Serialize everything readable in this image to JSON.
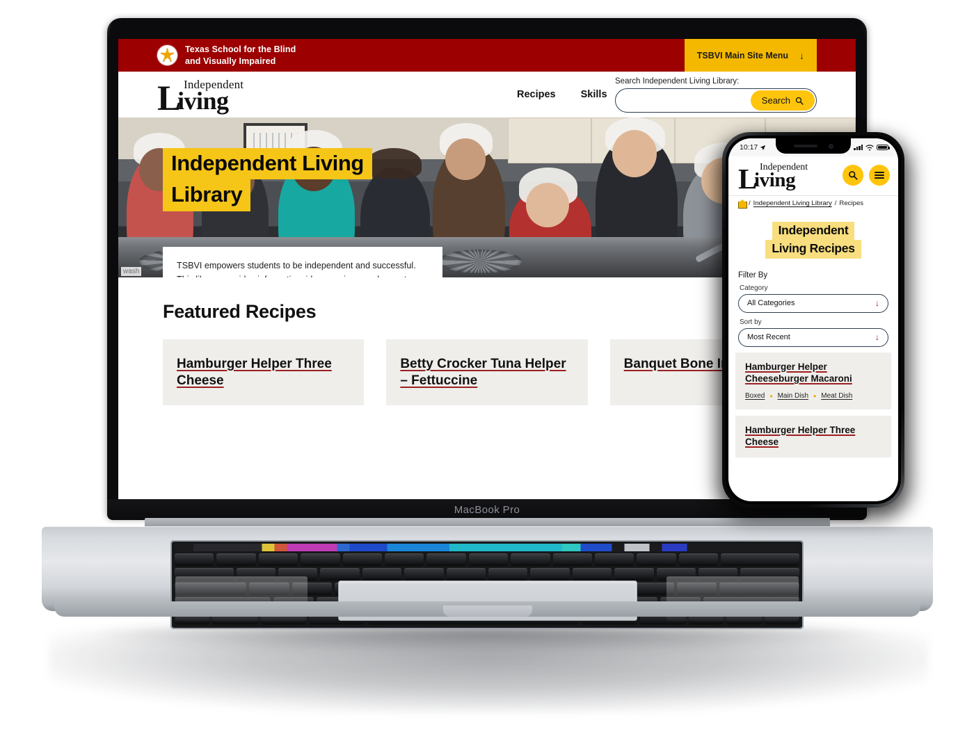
{
  "device": {
    "laptop_label": "MacBook Pro"
  },
  "desktop": {
    "topbar": {
      "org_line1": "Texas School for the Blind",
      "org_line2": "and Visually Impaired",
      "seal_icon": "tsbvi-star-seal-icon",
      "main_menu_label": "TSBVI Main Site Menu",
      "main_menu_arrow": "↓"
    },
    "logo": {
      "word_independent": "Independent",
      "word_l": "L",
      "word_iving": "iving"
    },
    "nav": [
      {
        "label": "Recipes"
      },
      {
        "label": "Skills"
      }
    ],
    "search": {
      "label": "Search Independent Living Library:",
      "value": "",
      "placeholder": "",
      "button_label": "Search",
      "button_icon": "search-icon"
    },
    "hero": {
      "title_line1": "Independent Living",
      "title_line2": "Library",
      "body": "TSBVI empowers students to be independent and successful. This library provides information, ideas, recipes, and more to provide opportunities for the independence of individuals who are blind, low vision, or deafblind.",
      "image_caption": "wash"
    },
    "featured": {
      "heading": "Featured Recipes",
      "cards": [
        {
          "title": "Hamburger Helper Three Cheese"
        },
        {
          "title": "Betty Crocker Tuna Helper – Fettuccine"
        },
        {
          "title": "Banquet Bone In Rib"
        }
      ]
    }
  },
  "mobile": {
    "status": {
      "time": "10:17",
      "location_icon": "location-arrow-icon",
      "signal_icon": "cellular-signal-icon",
      "wifi_icon": "wifi-icon",
      "battery_icon": "battery-full-icon"
    },
    "header": {
      "word_independent": "Independent",
      "word_l": "L",
      "word_iving": "iving",
      "search_icon": "search-icon",
      "menu_icon": "hamburger-menu-icon"
    },
    "breadcrumb": {
      "home_icon": "home-icon",
      "sep1": "/",
      "link": "Independent Living Library",
      "sep2": "/",
      "current": "Recipes"
    },
    "title": {
      "line1": "Independent",
      "line2": "Living Recipes"
    },
    "filter": {
      "heading": "Filter By",
      "category_label": "Category",
      "category_value": "All Categories",
      "sort_label": "Sort by",
      "sort_value": "Most Recent",
      "arrow_icon": "chevron-down-icon"
    },
    "recipes": [
      {
        "title": "Hamburger Helper Cheeseburger Macaroni",
        "tags": [
          "Boxed",
          "Main Dish",
          "Meat Dish"
        ]
      },
      {
        "title": "Hamburger Helper Three Cheese",
        "tags": []
      }
    ]
  },
  "colors": {
    "brand_red": "#9c0000",
    "brand_gold": "#FFC40C",
    "highlight_yellow": "#F5C518",
    "mobile_highlight": "#F8DE7E",
    "link_underline": "#9c2020",
    "card_bg": "#efeeeb"
  }
}
